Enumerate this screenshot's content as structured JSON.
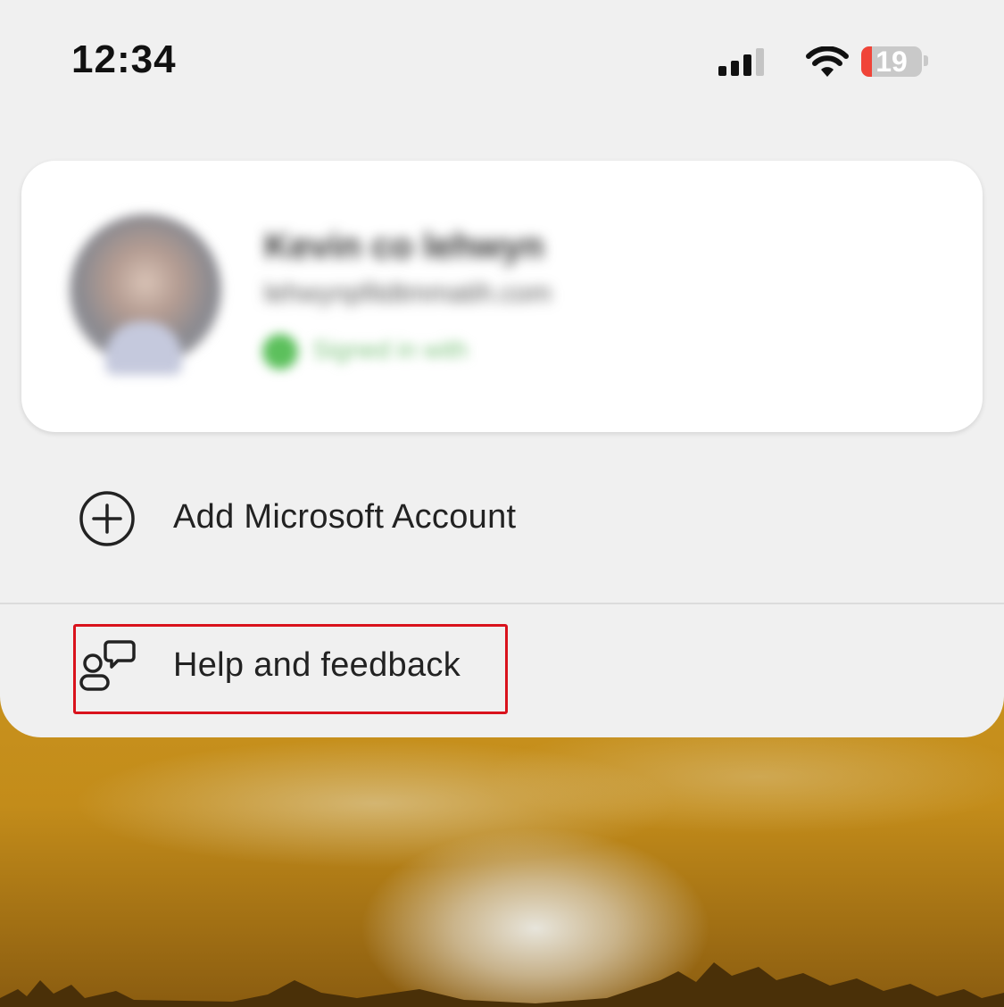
{
  "status_bar": {
    "time": "12:34",
    "battery_level": "19",
    "icons": [
      "cellular-signal-icon",
      "wifi-icon",
      "battery-icon"
    ]
  },
  "account_card": {
    "name": "Kevin co lehwyn",
    "email": "lehwynpfitdtmmatih.com",
    "status": "Signed in with",
    "status_color": "#5cc05c"
  },
  "menu": {
    "add_account_label": "Add Microsoft Account",
    "add_account_icon": "add-circle-icon",
    "help_label": "Help and feedback",
    "help_icon": "person-feedback-icon"
  },
  "colors": {
    "highlight": "#d9121c",
    "sheet_background": "#f0f0f0",
    "battery_low": "#f04438"
  }
}
